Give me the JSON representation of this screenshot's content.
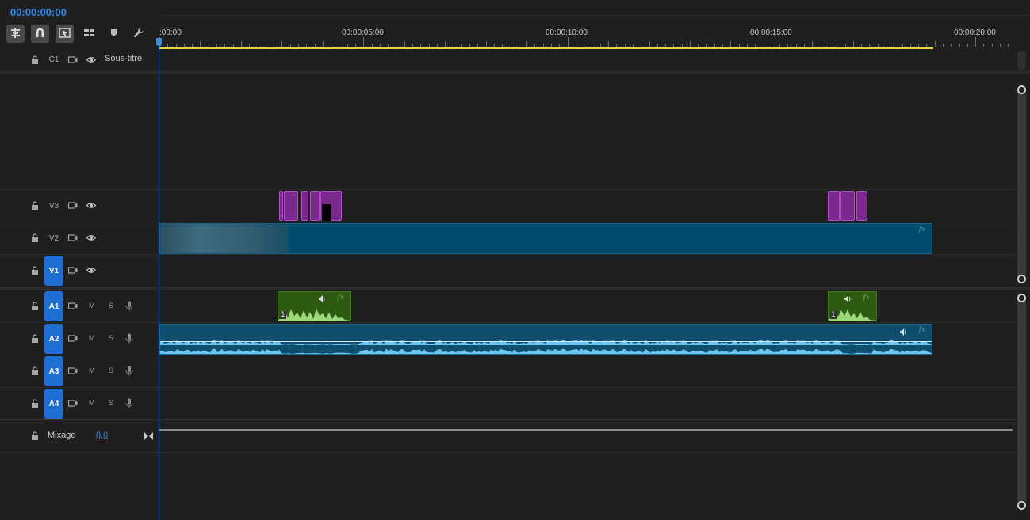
{
  "timecode": "00:00:00:00",
  "toolbar": {
    "tools": [
      {
        "name": "insert-sequence-nest-icon",
        "active": true
      },
      {
        "name": "snap-magnet-icon",
        "active": true
      },
      {
        "name": "linked-selection-icon",
        "active": true
      },
      {
        "name": "add-edit-icon",
        "active": false
      },
      {
        "name": "add-marker-icon",
        "active": false
      },
      {
        "name": "timeline-settings-wrench-icon",
        "active": false
      }
    ]
  },
  "ruler": {
    "labels": [
      ":00:00",
      "00:00:05:00",
      "00:00:10:00",
      "00:00:15:00",
      "00:00:20:00"
    ]
  },
  "tracks": {
    "c1": {
      "label": "C1",
      "name": "Sous-titre"
    },
    "v3": {
      "label": "V3"
    },
    "v2": {
      "label": "V2"
    },
    "v1": {
      "label": "V1",
      "targeted": true
    },
    "a1": {
      "label": "A1",
      "m": "M",
      "s": "S",
      "targeted": true
    },
    "a2": {
      "label": "A2",
      "m": "M",
      "s": "S",
      "targeted": true
    },
    "a3": {
      "label": "A3",
      "m": "M",
      "s": "S",
      "targeted": true
    },
    "a4": {
      "label": "A4",
      "m": "M",
      "s": "S",
      "targeted": true
    },
    "mix": {
      "label": "Mixage",
      "value": "0,0"
    }
  },
  "clips": {
    "v2_fx": "fx",
    "a1_clip1_fx": "fx",
    "a1_clip1_channel": "1",
    "a1_clip2_fx": "fx",
    "a1_clip2_channel": "1",
    "a2_fx": "fx"
  },
  "colors": {
    "accent": "#2d8ceb",
    "video_clip": "#004c6c",
    "graphic_clip": "#7a2a8c",
    "audio_clip_green": "#2e5a12",
    "audio_clip_blue": "#0e4f6e",
    "work_area": "#e6d43a"
  }
}
